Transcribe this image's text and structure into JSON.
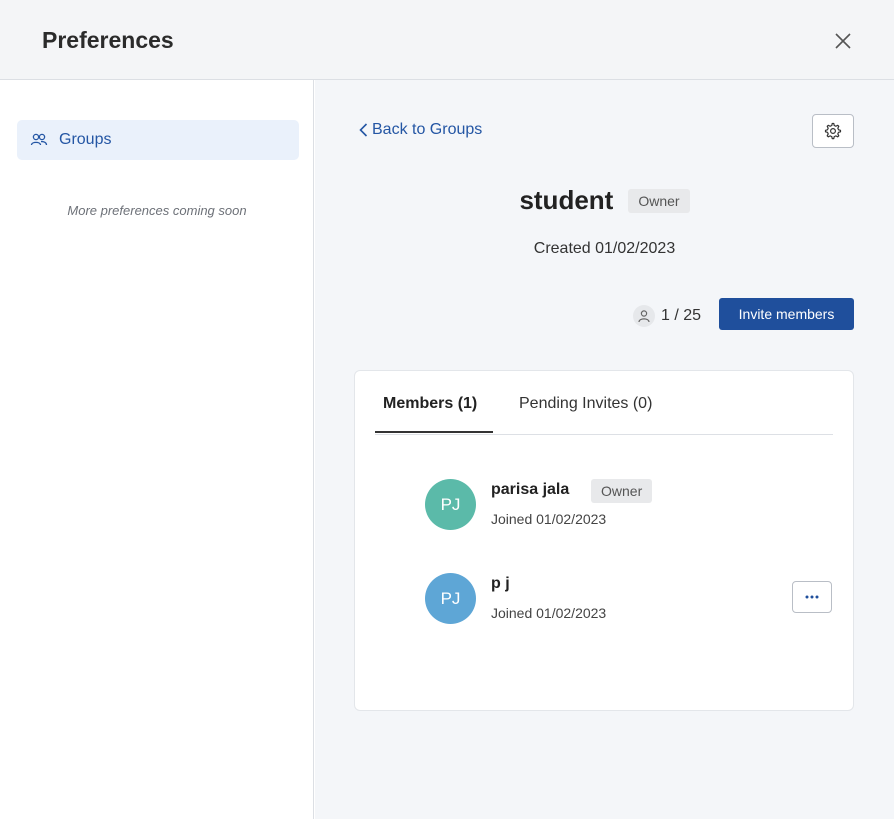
{
  "header": {
    "title": "Preferences",
    "close_icon": "close-icon"
  },
  "sidebar": {
    "items": [
      {
        "label": "Groups",
        "icon": "users-icon",
        "active": true
      }
    ],
    "note": "More preferences coming soon"
  },
  "main": {
    "back_label": "Back to Groups",
    "settings_icon": "gear-icon",
    "group": {
      "name": "student",
      "role_badge": "Owner",
      "created": "Created 01/02/2023"
    },
    "member_count": "1 / 25",
    "invite_label": "Invite members",
    "tabs": [
      {
        "label": "Members (1)",
        "active": true
      },
      {
        "label": "Pending Invites (0)",
        "active": false
      }
    ],
    "members": [
      {
        "initials": "PJ",
        "name": "parisa jala",
        "badge": "Owner",
        "joined": "Joined 01/02/2023",
        "avatar_color": "#5bbaa9"
      },
      {
        "initials": "PJ",
        "name": "p j",
        "badge": "",
        "joined": "Joined 01/02/2023",
        "avatar_color": "#5ea6d6",
        "more_icon": "more-horizontal-icon"
      }
    ]
  },
  "colors": {
    "accent": "#2456a4",
    "primary_button": "#1f4f9c",
    "active_nav_bg": "#eaf1fb"
  }
}
